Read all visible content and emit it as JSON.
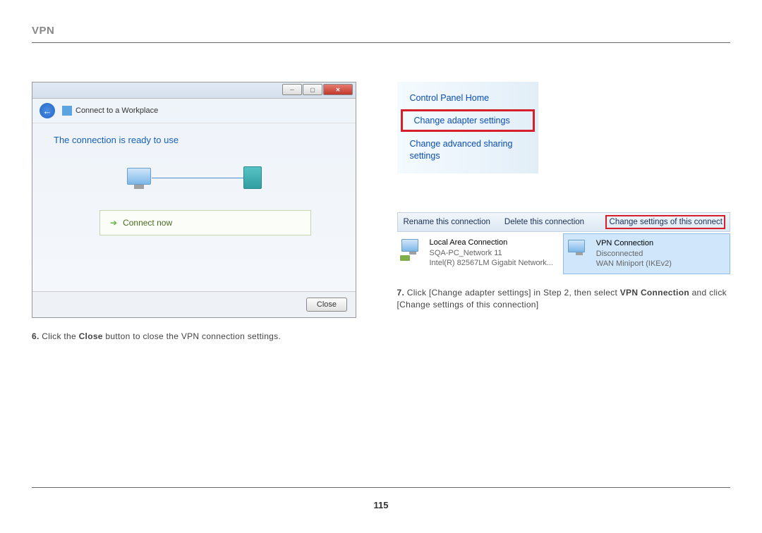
{
  "header": {
    "title": "VPN"
  },
  "left": {
    "dialog": {
      "breadcrumb": "Connect to a Workplace",
      "ready_text": "The connection is ready to use",
      "connect_now": "Connect now",
      "close_button": "Close"
    },
    "caption": {
      "num": "6.",
      "text_pre": " Click the ",
      "bold": "Close",
      "text_post": " button to close the VPN connection settings."
    }
  },
  "right": {
    "sidebar": {
      "home": "Control Panel Home",
      "adapter": "Change adapter settings",
      "sharing": "Change advanced sharing settings"
    },
    "toolbar": {
      "rename": "Rename this connection",
      "delete": "Delete this connection",
      "change": "Change settings of this connect"
    },
    "connections": [
      {
        "title": "Local Area Connection",
        "line2": "SQA-PC_Network 11",
        "line3": "Intel(R) 82567LM Gigabit Network..."
      },
      {
        "title": "VPN Connection",
        "line2": "Disconnected",
        "line3": "WAN Miniport (IKEv2)"
      }
    ],
    "caption": {
      "num": "7.",
      "text1": " Click [Change adapter settings] in Step 2, then select ",
      "bold1": "VPN Connection",
      "text2": " and click [Change settings of this connection]"
    }
  },
  "page_number": "115"
}
